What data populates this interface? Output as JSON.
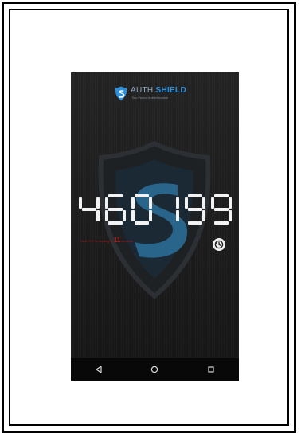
{
  "app": {
    "brand_part1": "AUTH",
    "brand_part2": "SHIELD",
    "tagline": "Two Factor Authentication"
  },
  "otp": {
    "code": "460199",
    "digits": [
      "4",
      "6",
      "0",
      "1",
      "9",
      "9"
    ]
  },
  "expiry": {
    "prefix": "Your OTP is expiring in",
    "seconds": "11",
    "suffix": "seconds"
  },
  "colors": {
    "brand_blue": "#2f8fd8",
    "otp_digit": "#f2f2f2",
    "expiry_red": "#c01818",
    "shield_blue": "#2b6f9a"
  },
  "icons": {
    "logo": "shield-logo-icon",
    "background": "shield-background-icon",
    "sync": "sync-time-icon",
    "nav_back": "back-triangle-icon",
    "nav_home": "home-circle-icon",
    "nav_recents": "recents-square-icon"
  }
}
